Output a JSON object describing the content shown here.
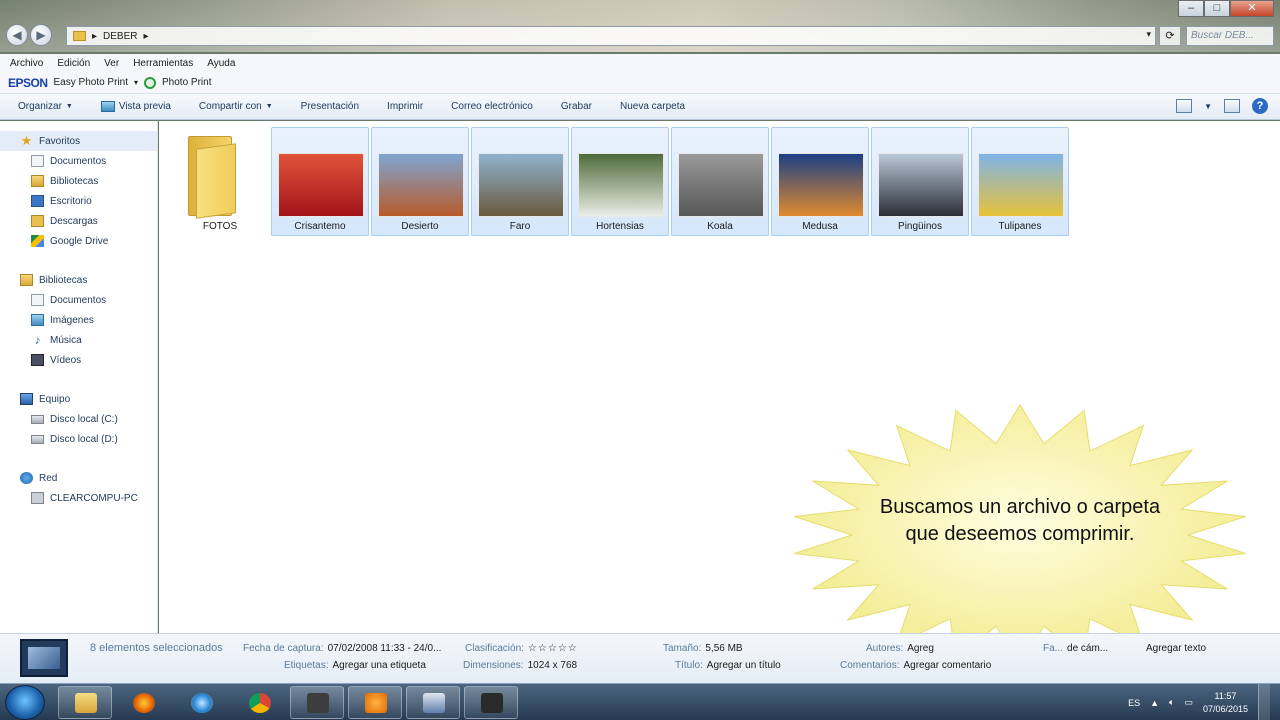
{
  "window": {
    "controls": [
      "–",
      "□",
      "✕"
    ],
    "breadcrumb": [
      "DEBER"
    ],
    "search_placeholder": "Buscar DEB..."
  },
  "menu": [
    "Archivo",
    "Edición",
    "Ver",
    "Herramientas",
    "Ayuda"
  ],
  "epson": {
    "brand": "EPSON",
    "app": "Easy Photo Print",
    "photo_print": "Photo Print"
  },
  "toolbar": {
    "organize": "Organizar",
    "preview": "Vista previa",
    "share": "Compartir con",
    "slideshow": "Presentación",
    "print": "Imprimir",
    "email": "Correo electrónico",
    "burn": "Grabar",
    "new_folder": "Nueva carpeta"
  },
  "nav": {
    "favorites": {
      "label": "Favoritos",
      "items": [
        "Documentos",
        "Bibliotecas",
        "Escritorio",
        "Descargas",
        "Google Drive"
      ]
    },
    "libraries": {
      "label": "Bibliotecas",
      "items": [
        "Documentos",
        "Imágenes",
        "Música",
        "Vídeos"
      ]
    },
    "computer": {
      "label": "Equipo",
      "items": [
        "Disco local (C:)",
        "Disco local (D:)"
      ]
    },
    "network": {
      "label": "Red",
      "items": [
        "CLEARCOMPU-PC"
      ]
    }
  },
  "files": [
    {
      "name": "FOTOS",
      "type": "folder",
      "selected": false
    },
    {
      "name": "Crisantemo",
      "type": "image",
      "selected": true,
      "colors": [
        "#e0543a",
        "#a3141a"
      ]
    },
    {
      "name": "Desierto",
      "type": "image",
      "selected": true,
      "colors": [
        "#7fa6d2",
        "#b75a2a"
      ]
    },
    {
      "name": "Faro",
      "type": "image",
      "selected": true,
      "colors": [
        "#8fb3cf",
        "#6b5a3e"
      ]
    },
    {
      "name": "Hortensias",
      "type": "image",
      "selected": true,
      "colors": [
        "#4f6b3a",
        "#e9ede6"
      ]
    },
    {
      "name": "Koala",
      "type": "image",
      "selected": true,
      "colors": [
        "#9a9a9a",
        "#575757"
      ]
    },
    {
      "name": "Medusa",
      "type": "image",
      "selected": true,
      "colors": [
        "#1c3f86",
        "#e08a2e"
      ]
    },
    {
      "name": "Pingüinos",
      "type": "image",
      "selected": true,
      "colors": [
        "#b9c8d8",
        "#2a2e36"
      ]
    },
    {
      "name": "Tulipanes",
      "type": "image",
      "selected": true,
      "colors": [
        "#7fb4e8",
        "#e7c23a"
      ]
    }
  ],
  "callout": {
    "text": "Buscamos un archivo o carpeta que deseemos comprimir."
  },
  "details": {
    "summary": "8 elementos seleccionados",
    "capture_date_label": "Fecha de captura:",
    "capture_date": "07/02/2008 11:33 - 24/0...",
    "tags_label": "Etiquetas:",
    "tags": "Agregar una etiqueta",
    "rating_label": "Clasificación:",
    "rating": "☆☆☆☆☆",
    "dimensions_label": "Dimensiones:",
    "dimensions": "1024 x 768",
    "size_label": "Tamaño:",
    "size": "5,56 MB",
    "title_label": "Título:",
    "title": "Agregar un título",
    "authors_label": "Autores:",
    "authors": "Agreg",
    "comments_label": "Comentarios:",
    "comments": "Agregar comentario",
    "camera_label": "Fa...",
    "camera": "de cám...",
    "add_text": "Agregar texto"
  },
  "taskbar": {
    "lang": "ES",
    "time": "11:57",
    "date": "07/06/2015"
  }
}
